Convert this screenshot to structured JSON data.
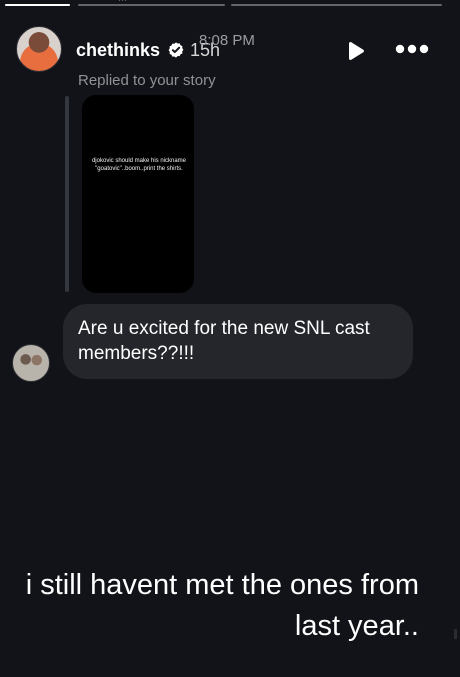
{
  "status": {
    "top_partial_text": "..."
  },
  "header": {
    "username": "chethinks",
    "age": "15h",
    "clock_overlay": "8:08 PM"
  },
  "reply": {
    "replied_label": "Replied to your story",
    "story_preview_text": "djokovic should make his nickname \"goatovic\"..boom..print the shirts."
  },
  "message": {
    "text": "Are u excited for the new SNL cast members??!!!"
  },
  "caption": {
    "line1": "i still havent met the ones from",
    "line2": "last year.."
  },
  "story_progress": {
    "segments": [
      {
        "fill": 1.0
      },
      {
        "fill": 0.0
      },
      {
        "fill": 0.0
      }
    ]
  },
  "icons": {
    "verified": "verified-badge-icon",
    "play": "play-icon",
    "more": "more-options-icon"
  },
  "colors": {
    "background": "#111318",
    "bubble": "#24262c",
    "muted_text": "#8f9297",
    "accent": "#ffffff"
  }
}
